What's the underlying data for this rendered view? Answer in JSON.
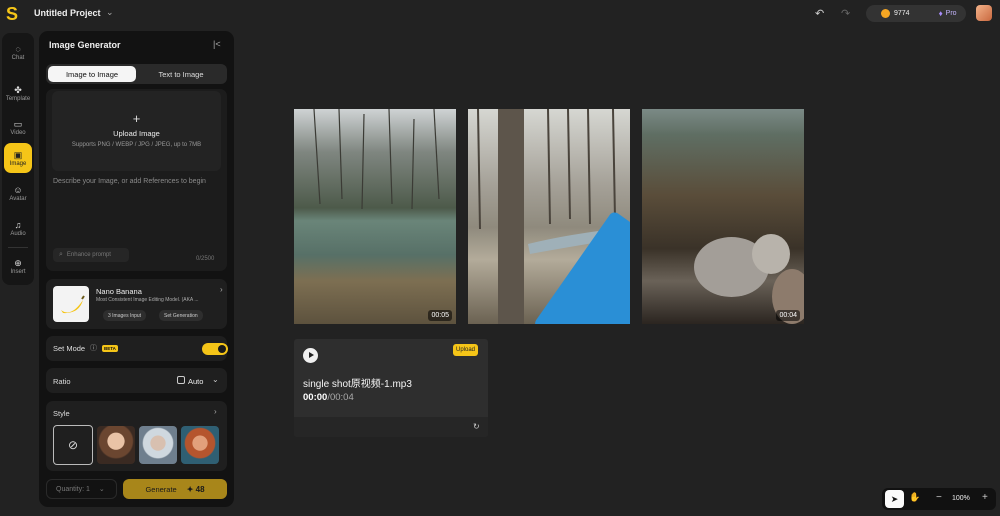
{
  "topbar": {
    "project_title": "Untitled Project",
    "credits": "9774",
    "plan": "Pro"
  },
  "rail": {
    "items": [
      {
        "label": "Chat",
        "icon": "chat-icon"
      },
      {
        "label": "Template",
        "icon": "template-icon"
      },
      {
        "label": "Video",
        "icon": "video-icon"
      },
      {
        "label": "Image",
        "icon": "image-icon",
        "active": true
      },
      {
        "label": "Avatar",
        "icon": "avatar-icon"
      },
      {
        "label": "Audio",
        "icon": "audio-icon"
      },
      {
        "label": "Insert",
        "icon": "insert-icon"
      }
    ]
  },
  "panel": {
    "title": "Image Generator",
    "tabs": [
      "Image to Image",
      "Text to Image"
    ],
    "upload": {
      "title": "Upload Image",
      "hint": "Supports PNG / WEBP / JPG / JPEG, up to 7MB"
    },
    "prompt_placeholder": "Describe your Image, or add References to begin",
    "enhance_label": "Enhance prompt",
    "char_count": "0/2500",
    "model": {
      "name": "Nano Banana",
      "description": "Most Consistent Image Editing Model. (AKA ...",
      "chip1": "3 Images Input",
      "chip2": "Set Generation"
    },
    "set_mode": {
      "label": "Set Mode",
      "badge": "BETA",
      "enabled": true
    },
    "ratio": {
      "label": "Ratio",
      "value": "Auto"
    },
    "style": {
      "label": "Style"
    },
    "quantity": "Quantity: 1",
    "generate": {
      "label": "Generate",
      "cost": "48"
    }
  },
  "canvas": {
    "images": [
      {
        "duration": "00:05"
      },
      {
        "duration": ""
      },
      {
        "duration": "00:04"
      }
    ],
    "audio": {
      "badge": "Upload",
      "name": "single shot原视频-1.mp3",
      "current": "00:00",
      "total": "/00:04"
    }
  },
  "toolbar": {
    "zoom": "100%"
  },
  "colors": {
    "accent": "#f5c518",
    "background": "#222222",
    "panel": "#121212"
  }
}
